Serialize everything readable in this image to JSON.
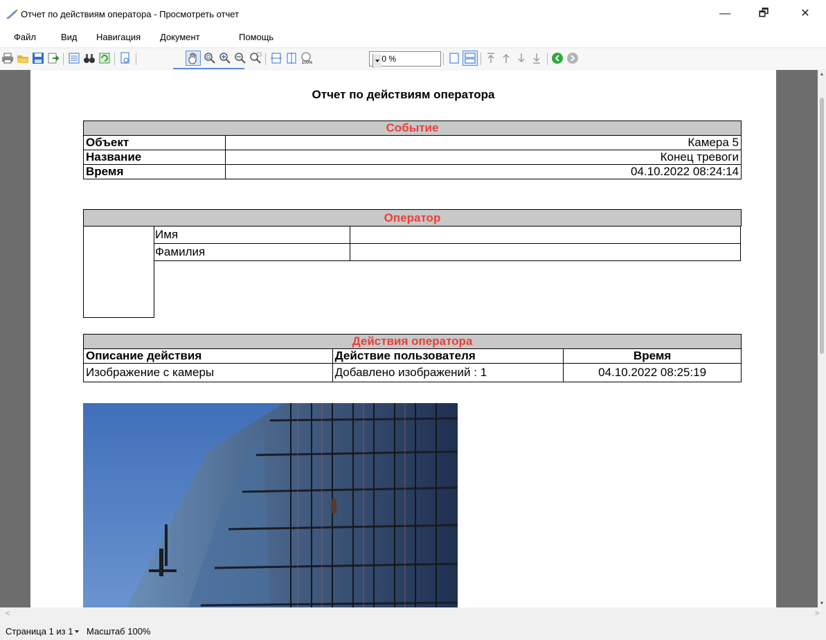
{
  "window": {
    "title": "Отчет по действиям оператора - Просмотреть отчет",
    "minimize_icon": "—",
    "maximize_icon": "🗗",
    "close_icon": "✕"
  },
  "menu": [
    {
      "label": "Файл"
    },
    {
      "label": "Вид"
    },
    {
      "label": "Навигация"
    },
    {
      "label": "Документ"
    },
    {
      "label": "Помощь"
    }
  ],
  "toolbar": {
    "zoom_value": "100 %",
    "icons": [
      "print-icon",
      "open-icon",
      "save-icon",
      "export-icon",
      "toc-icon",
      "find-icon",
      "refresh-icon",
      "page-setup-icon",
      "hand-icon",
      "zoom-rect-icon",
      "zoom-in-icon",
      "zoom-out-icon",
      "zoom-region-icon",
      "fit-width-icon",
      "fit-page-icon",
      "zoom-100-icon",
      "single-page-icon",
      "two-page-icon",
      "first-page-icon",
      "prev-page-icon",
      "next-page-icon",
      "last-page-icon",
      "back-icon",
      "forward-icon"
    ]
  },
  "report": {
    "title": "Отчет по действиям оператора",
    "event": {
      "header": "Событие",
      "rows": [
        {
          "label": "Объект",
          "value": "Камера 5"
        },
        {
          "label": "Название",
          "value": "Конец тревоги"
        },
        {
          "label": "Время",
          "value": "04.10.2022 08:24:14"
        }
      ]
    },
    "operator": {
      "header": "Оператор",
      "rows": [
        {
          "label": "Имя",
          "value": ""
        },
        {
          "label": "Фамилия",
          "value": ""
        }
      ]
    },
    "actions": {
      "header": "Действия оператора",
      "columns": [
        "Описание действия",
        "Действие пользователя",
        "Время"
      ],
      "rows": [
        [
          "Изображение с камеры",
          "Добавлено изображений : 1",
          "04.10.2022 08:25:19"
        ]
      ]
    }
  },
  "status": {
    "page": "Страница 1 из 1",
    "zoom": "Масштаб 100%"
  },
  "colors": {
    "section_header_text": "#e8403b",
    "section_header_bg": "#c8c8c8",
    "viewport_bg": "#6d6d6d"
  }
}
